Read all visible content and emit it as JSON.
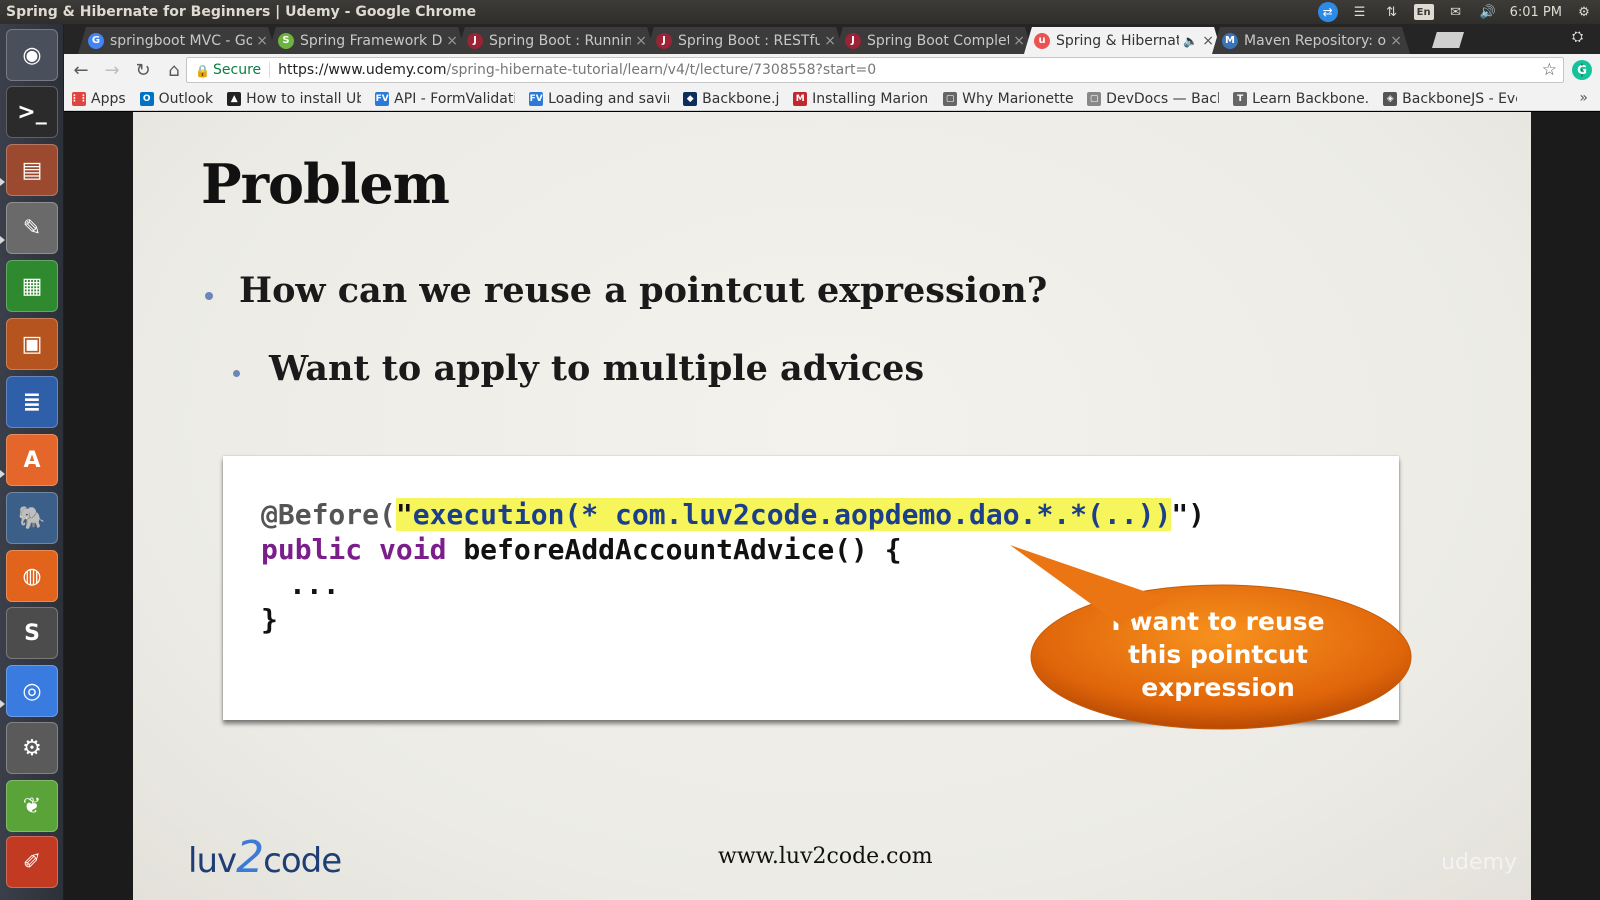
{
  "window": {
    "title": "Spring & Hibernate for Beginners | Udemy - Google Chrome"
  },
  "tray": {
    "keyboard": "En",
    "time": "6:01 PM"
  },
  "launcher": {
    "items": [
      {
        "name": "ubuntu-dash",
        "glyph": "◉",
        "color": "#4a4f5c"
      },
      {
        "name": "terminal",
        "glyph": ">_",
        "color": "#2b2b2b"
      },
      {
        "name": "files",
        "glyph": "▤",
        "color": "#9b4a2f"
      },
      {
        "name": "system-settings",
        "glyph": "✎",
        "color": "#6a6a6a"
      },
      {
        "name": "libreoffice-calc",
        "glyph": "▦",
        "color": "#2f8a2f"
      },
      {
        "name": "libreoffice-impress",
        "glyph": "▣",
        "color": "#b5541f"
      },
      {
        "name": "libreoffice-writer",
        "glyph": "≣",
        "color": "#2f5fa8"
      },
      {
        "name": "software-center",
        "glyph": "A",
        "color": "#e4662a"
      },
      {
        "name": "pgadmin",
        "glyph": "🐘",
        "color": "#3c5f8a"
      },
      {
        "name": "firefox",
        "glyph": "◍",
        "color": "#e2641c"
      },
      {
        "name": "sublime-text",
        "glyph": "S",
        "color": "#4c4c4c"
      },
      {
        "name": "chrome",
        "glyph": "◎",
        "color": "#3a7be0"
      },
      {
        "name": "eclipse-java-ee",
        "glyph": "⚙",
        "color": "#5a5a5a"
      },
      {
        "name": "spring-tool-suite",
        "glyph": "❦",
        "color": "#5aa339"
      },
      {
        "name": "editor",
        "glyph": "✐",
        "color": "#c23a22"
      }
    ]
  },
  "tabs": [
    {
      "title": "springboot MVC - Go",
      "icon": "G",
      "icon_color": "#4285f4",
      "active": false
    },
    {
      "title": "Spring Framework Do",
      "icon": "S",
      "icon_color": "#6db33f",
      "active": false
    },
    {
      "title": "Spring Boot : Runnin",
      "icon": "J",
      "icon_color": "#9b2335",
      "active": false
    },
    {
      "title": "Spring Boot : RESTful",
      "icon": "J",
      "icon_color": "#9b2335",
      "active": false
    },
    {
      "title": "Spring Boot Complet",
      "icon": "J",
      "icon_color": "#9b2335",
      "active": false
    },
    {
      "title": "Spring & Hibernate",
      "icon": "u",
      "icon_color": "#ec5252",
      "active": true
    },
    {
      "title": "Maven Repository: o",
      "icon": "M",
      "icon_color": "#3b73b9",
      "active": false
    }
  ],
  "toolbar": {
    "secure_label": "Secure",
    "url_host": "https://www.udemy.com",
    "url_path": "/spring-hibernate-tutorial/learn/v4/t/lecture/7308558?start=0"
  },
  "bookmarks": [
    {
      "label": "Apps",
      "icon": "⋮⋮",
      "icon_color": "#e0443e"
    },
    {
      "label": "Outlook",
      "icon": "O",
      "icon_color": "#0072c6"
    },
    {
      "label": "How to install Ubu",
      "icon": "▲",
      "icon_color": "#222"
    },
    {
      "label": "API - FormValidati",
      "icon": "FV",
      "icon_color": "#2d7ad6"
    },
    {
      "label": "Loading and savin",
      "icon": "FV",
      "icon_color": "#2d7ad6"
    },
    {
      "label": "Backbone.js",
      "icon": "◆",
      "icon_color": "#0b2e5a"
    },
    {
      "label": "Installing Marione",
      "icon": "M",
      "icon_color": "#c1272d"
    },
    {
      "label": "Why Marionette?",
      "icon": "▢",
      "icon_color": "#666"
    },
    {
      "label": "DevDocs — Backb",
      "icon": "▢",
      "icon_color": "#888"
    },
    {
      "label": "Learn Backbone.js",
      "icon": "T",
      "icon_color": "#666"
    },
    {
      "label": "BackboneJS - Even",
      "icon": "◈",
      "icon_color": "#555"
    }
  ],
  "slide": {
    "title": "Problem",
    "bullet1": "How can we reuse a pointcut expression?",
    "bullet2": "Want to apply to multiple advices",
    "code": {
      "l1_prefix": "@Before(",
      "l1_quote_open": "\"",
      "l1_highlight": "execution(* com.luv2code.aopdemo.dao.*.*(..))",
      "l1_quote_close": "\"",
      "l1_suffix": ")",
      "l2_kw1": "public",
      "l2_kw2": "void",
      "l2_rest": "beforeAddAccountAdvice() {",
      "l3": "...",
      "l4": "}"
    },
    "callout_line1": "I want to reuse",
    "callout_line2": "this pointcut",
    "callout_line3": "expression",
    "footer_logo_a": "luv",
    "footer_logo_b": "2",
    "footer_logo_c": "code",
    "footer_url": "www.luv2code.com",
    "watermark": "udemy"
  }
}
